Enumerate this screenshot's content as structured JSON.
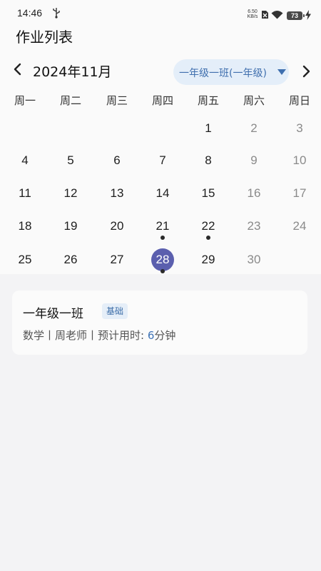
{
  "status_bar": {
    "time": "14:46",
    "net_speed_value": "6.50",
    "net_speed_unit": "KB/s",
    "battery": "73",
    "icons": [
      "usb-icon",
      "no-sim-icon",
      "wifi-icon",
      "battery-icon",
      "charging-bolt-icon"
    ]
  },
  "header": {
    "title": "作业列表"
  },
  "calendar": {
    "month_label": "2024年11月",
    "class_selector": "一年级一班(一年级)",
    "weekdays": [
      "周一",
      "周二",
      "周三",
      "周四",
      "周五",
      "周六",
      "周日"
    ],
    "weeks": [
      [
        "",
        "",
        "",
        "",
        "1",
        "2",
        "3"
      ],
      [
        "4",
        "5",
        "6",
        "7",
        "8",
        "9",
        "10"
      ],
      [
        "11",
        "12",
        "13",
        "14",
        "15",
        "16",
        "17"
      ],
      [
        "18",
        "19",
        "20",
        "21",
        "22",
        "23",
        "24"
      ],
      [
        "25",
        "26",
        "27",
        "28",
        "29",
        "30",
        ""
      ]
    ],
    "selected_day": "28",
    "days_with_homework": [
      "21",
      "22",
      "28"
    ],
    "colors": {
      "selected": "#5b5fae",
      "weekend": "#8a8a8a",
      "selector_bg": "#e4eef9",
      "selector_text": "#3f6fae"
    }
  },
  "homework_list": [
    {
      "title": "一年级一班",
      "badge": "基础",
      "meta_prefix": "数学丨周老师丨预计用时: ",
      "minutes": "6",
      "minutes_unit": "分钟"
    }
  ]
}
